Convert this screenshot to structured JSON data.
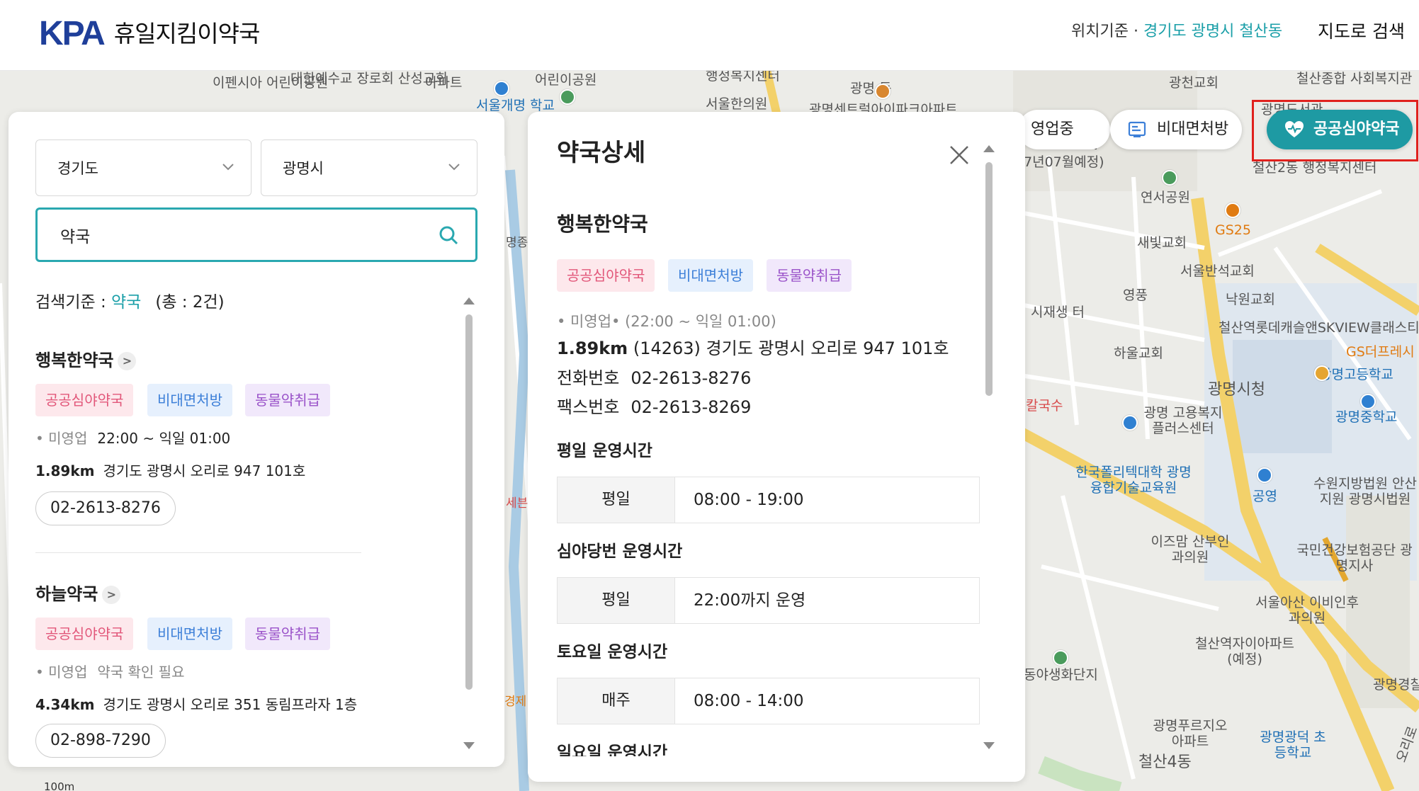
{
  "header": {
    "logo_mark": "KPA",
    "logo_text": "휴일지킴이약국",
    "location_prefix": "위치기준 · ",
    "location_value": "경기도 광명시 철산동",
    "map_search": "지도로 검색"
  },
  "colors": {
    "accent": "#1e9aa3",
    "brand_blue": "#1f3f9a",
    "highlight_red": "#e0211d",
    "tag_pink": "#e2577a",
    "tag_blue": "#3c7fd8",
    "tag_purple": "#9a52c9"
  },
  "filters": {
    "province": "경기도",
    "city": "광명시",
    "query": "약국"
  },
  "results": {
    "criteria_label": "검색기준 : ",
    "criteria_query": "약국",
    "total": "(총 : 2건)",
    "items": [
      {
        "name": "행복한약국",
        "tags": [
          "공공심야약국",
          "비대면처방",
          "동물약취급"
        ],
        "status": "미영업",
        "hours": "22:00 ~ 익일 01:00",
        "distance": "1.89km",
        "address": "경기도 광명시 오리로 947 101호",
        "phone": "02-2613-8276"
      },
      {
        "name": "하늘약국",
        "tags": [
          "공공심야약국",
          "비대면처방",
          "동물약취급"
        ],
        "status": "미영업",
        "hours": "약국 확인 필요",
        "distance": "4.34km",
        "address": "경기도 광명시 오리로 351 동림프라자 1층",
        "phone": "02-898-7290"
      }
    ]
  },
  "detail": {
    "title": "약국상세",
    "name": "행복한약국",
    "tags": [
      "공공심야약국",
      "비대면처방",
      "동물약취급"
    ],
    "status_line": "• 미영업•  (22:00 ~ 익일 01:00)",
    "distance": "1.89km",
    "address": "(14263) 경기도 광명시 오리로 947 101호",
    "phone_label": "전화번호",
    "phone": "02-2613-8276",
    "fax_label": "팩스번호",
    "fax": "02-2613-8269",
    "weekday_title": "평일 운영시간",
    "weekday_key": "평일",
    "weekday_val": "08:00 - 19:00",
    "night_title": "심야당번 운영시간",
    "night_key": "평일",
    "night_val": "22:00까지 운영",
    "sat_title": "토요일 운영시간",
    "sat_key": "매주",
    "sat_val": "08:00 - 14:00",
    "sun_title": "일요일 운영시간"
  },
  "map_filters": {
    "open": "영업중",
    "telemed": "비대면처방",
    "night": "공공심야약국"
  },
  "map_labels": [
    "이펜시아 어린이공원",
    "대한예수교 장로회 산성교회",
    "아파트",
    "서울개명 학교",
    "어린이공원",
    "행정복지센터",
    "서울한의원",
    "광명 동",
    "광명센트럴아이파크아파트",
    "광천교회",
    "철산종합 사회복지관",
    "광명도서관",
    "KVIEW",
    "7년07월예정)",
    "철산2동 행정복지센터",
    "연서공원",
    "GS25",
    "새빛교회",
    "서울반석교회",
    "영풍",
    "낙원교회",
    "시재생 터",
    "철산역롯데캐슬앤SKVIEW클래스티",
    "GS더프레시",
    "하울교회",
    "광명고등학교",
    "광명시청",
    "광명 고용복지 플러스센터",
    "광명중학교",
    "칼국수",
    "한국폴리텍대학 광명융합기술교육원",
    "공영",
    "수원지방법원 안산지원 광명시법원",
    "이즈맘 산부인과의원",
    "국민건강보험공단 광명지사",
    "서울아산 이비인후과의원",
    "철산역자이아파트 (예정)",
    "동야생화단지",
    "광명경찰",
    "광명푸르지오 아파트",
    "광명광덕 초등학교",
    "철산4동",
    "오리로",
    "명종 자지",
    "세븐",
    "경제 시청",
    "100m"
  ]
}
